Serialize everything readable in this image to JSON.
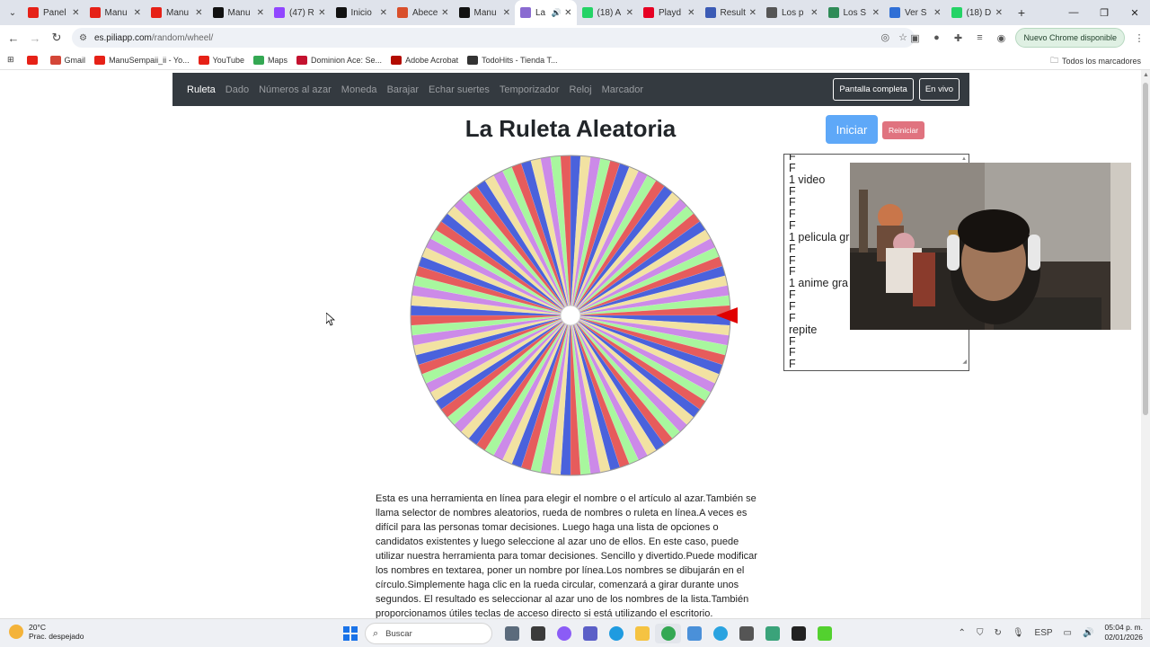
{
  "browser": {
    "tabs": [
      {
        "label": "Panel",
        "icon": "youtube-icon",
        "color": "#e62117"
      },
      {
        "label": "Manu",
        "icon": "youtube-icon",
        "color": "#e62117"
      },
      {
        "label": "Manu",
        "icon": "youtube-icon",
        "color": "#e62117"
      },
      {
        "label": "Manu",
        "icon": "kick-icon",
        "color": "#111111"
      },
      {
        "label": "(47) R",
        "icon": "twitch-icon",
        "color": "#9146ff"
      },
      {
        "label": "Inicio",
        "icon": "x-icon",
        "color": "#111111"
      },
      {
        "label": "Abece",
        "icon": "abecedario-icon",
        "color": "#d94f2b"
      },
      {
        "label": "Manu",
        "icon": "tiktok-icon",
        "color": "#111111"
      },
      {
        "label": "La",
        "icon": "wheel-icon",
        "color": "#8a6bd1",
        "active": true
      },
      {
        "label": "(18) A",
        "icon": "whatsapp-icon",
        "color": "#25d366"
      },
      {
        "label": "Playd",
        "icon": "pinterest-icon",
        "color": "#e60023"
      },
      {
        "label": "Result",
        "icon": "result-icon",
        "color": "#3b5bb5"
      },
      {
        "label": "Los p",
        "icon": "wikipedia-icon",
        "color": "#555555"
      },
      {
        "label": "Los S",
        "icon": "link-icon",
        "color": "#2e8b57"
      },
      {
        "label": "Ver S",
        "icon": "globe-icon",
        "color": "#2f6fd6"
      },
      {
        "label": "(18) D",
        "icon": "whatsapp-icon",
        "color": "#25d366"
      }
    ],
    "new_tab": "+",
    "url_host": "es.piliapp.com",
    "url_path": "/random/wheel/",
    "update_label": "Nuevo Chrome disponible",
    "bookmarks": [
      {
        "label": "",
        "icon": "youtube-icon",
        "color": "#e62117"
      },
      {
        "label": "Gmail",
        "icon": "gmail-icon",
        "color": "#d44638"
      },
      {
        "label": "ManuSempaii_ii - Yo...",
        "icon": "youtube-icon",
        "color": "#e62117"
      },
      {
        "label": "YouTube",
        "icon": "youtube-icon",
        "color": "#e62117"
      },
      {
        "label": "Maps",
        "icon": "maps-icon",
        "color": "#34a853"
      },
      {
        "label": "Dominion Ace: Se...",
        "icon": "md-icon",
        "color": "#c4122f"
      },
      {
        "label": "Adobe Acrobat",
        "icon": "acrobat-icon",
        "color": "#b30b00"
      },
      {
        "label": "TodoHits - Tienda T...",
        "icon": "todohits-icon",
        "color": "#333333"
      }
    ],
    "all_bookmarks": "Todos los marcadores"
  },
  "site": {
    "nav": [
      "Ruleta",
      "Dado",
      "Números al azar",
      "Moneda",
      "Barajar",
      "Echar suertes",
      "Temporizador",
      "Reloj",
      "Marcador"
    ],
    "fullscreen": "Pantalla completa",
    "live": "En vivo",
    "title": "La Ruleta Aleatoria",
    "start": "Iniciar",
    "reset": "Reiniciar",
    "names": [
      "F",
      "F",
      "1 video",
      "F",
      "F",
      "F",
      "F",
      "1 pelicula gr",
      "F",
      "F",
      "F",
      "1 anime gra",
      "F",
      "F",
      "F",
      "repite",
      "F",
      "F",
      "F"
    ],
    "wheel_colors": [
      "#4a62dc",
      "#f2e2a2",
      "#cc8ae8",
      "#a8f79e",
      "#e65c5c"
    ],
    "wheel_segments": 100,
    "description": "Esta es una herramienta en línea para elegir el nombre o el artículo al azar.También se llama selector de nombres aleatorios, rueda de nombres o ruleta en línea.A veces es difícil para las personas tomar decisiones. Luego haga una lista de opciones o candidatos existentes y luego seleccione al azar uno de ellos. En este caso, puede utilizar nuestra herramienta para tomar decisiones. Sencillo y divertido.Puede modificar los nombres en textarea, poner un nombre por línea.Los nombres se dibujarán en el círculo.Simplemente haga clic en la rueda circular, comenzará a girar durante unos segundos. El resultado es seleccionar al azar uno de los nombres de la lista.También proporcionamos útiles teclas de acceso directo si está utilizando el escritorio."
  },
  "taskbar": {
    "temp": "20°C",
    "weather": "Prac. despejado",
    "search": "Buscar",
    "lang": "ESP",
    "time": "05:04 p. m.",
    "date": "02/01/2026"
  }
}
